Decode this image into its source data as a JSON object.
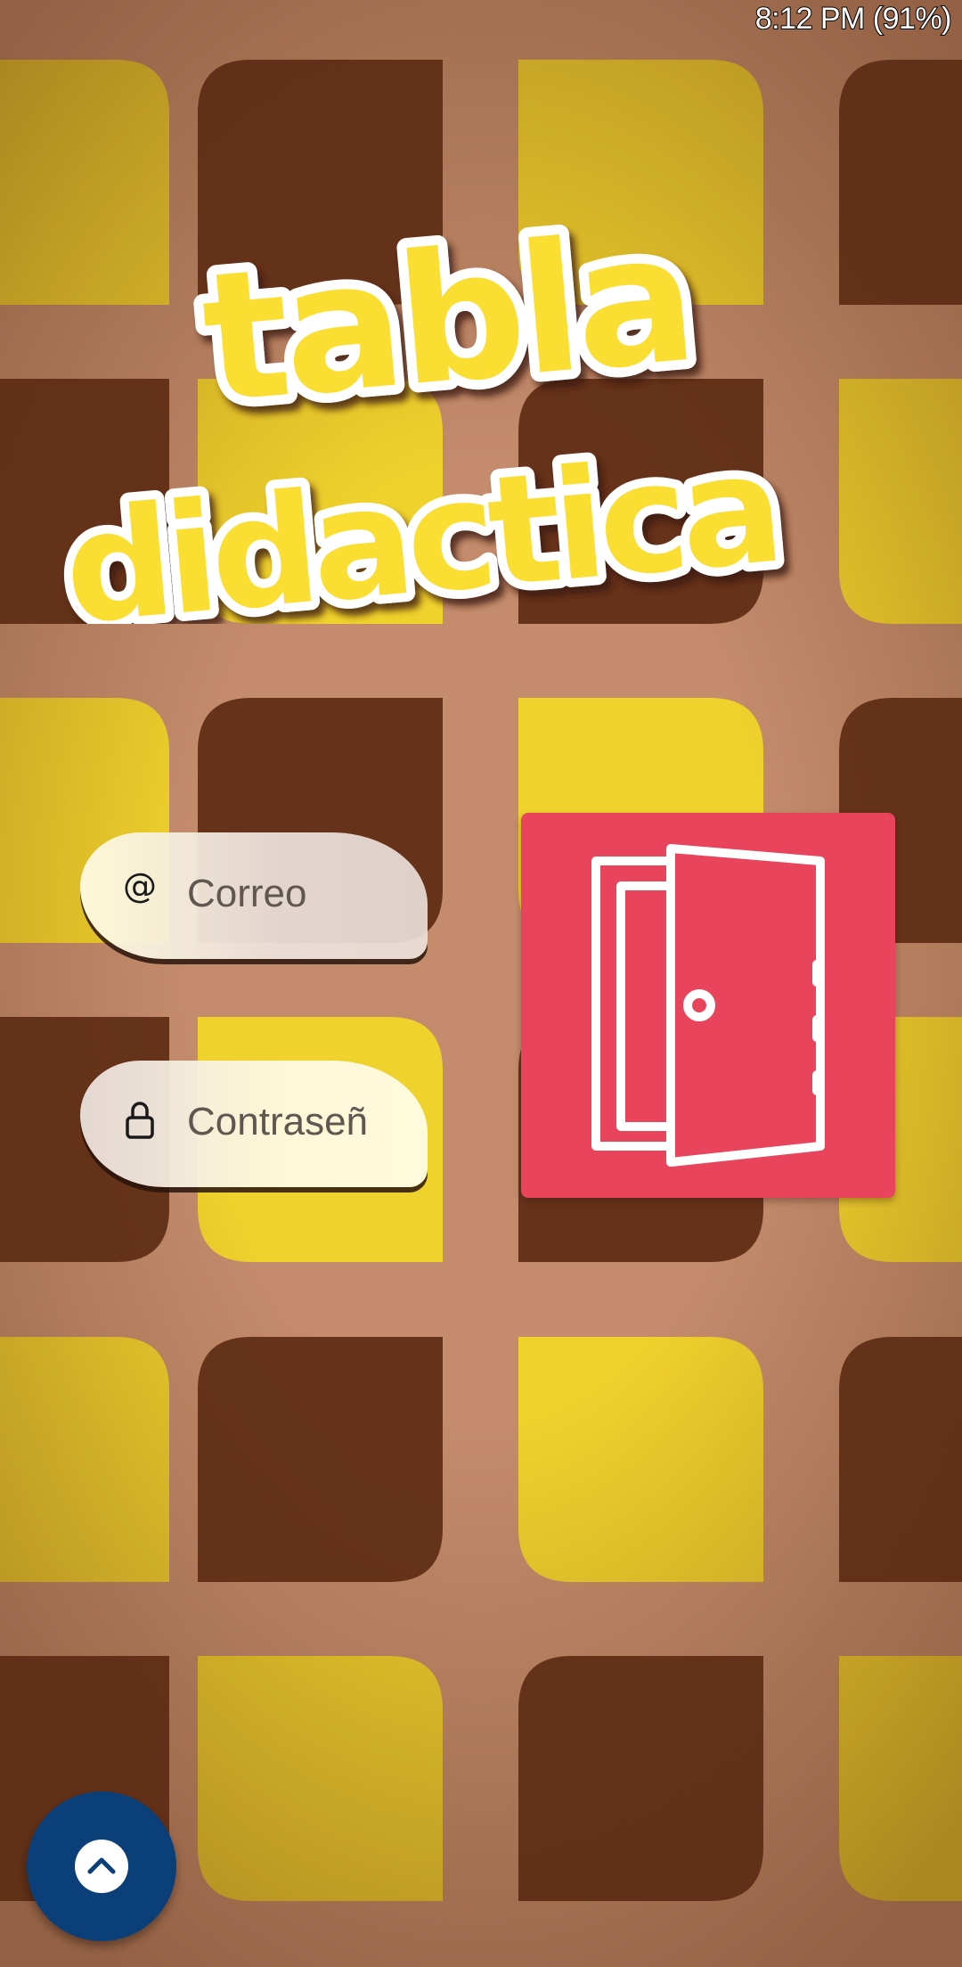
{
  "status_bar": {
    "text": "8:12 PM (91%)"
  },
  "logo": {
    "line1": "tabla",
    "line2": "didactica"
  },
  "login": {
    "email_placeholder": "Correo",
    "password_placeholder": "Contraseñ"
  },
  "icons": {
    "email": "at-sign-icon",
    "password": "lock-icon",
    "enter": "open-door-icon",
    "fab": "chevron-up-icon"
  },
  "colors": {
    "background": "#c48c6c",
    "tile_brown": "#66321a",
    "tile_yellow": "#f0d22c",
    "enter_button": "#e8445c",
    "fab": "#0a3f78",
    "logo_yellow": "#fadf30"
  }
}
